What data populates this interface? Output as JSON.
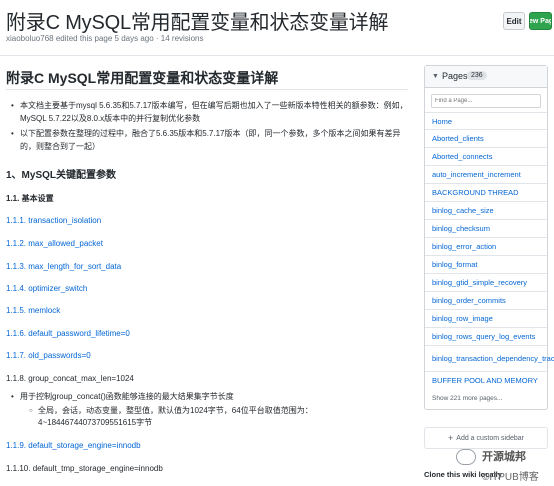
{
  "header": {
    "title": "附录C MySQL常用配置变量和状态变量详解",
    "meta": "xiaoboluo768 edited this page 5 days ago · 14 revisions",
    "edit_label": "Edit",
    "new_page_label": "New Page"
  },
  "content": {
    "h1": "附录C MySQL常用配置变量和状态变量详解",
    "bullets": [
      "本文档主要基于mysql 5.6.35和5.7.17版本编写，但在编写后期也加入了一些新版本特性相关的额参数：例如，MySQL 5.7.22以及8.0.x版本中的并行复制优化参数",
      "以下配置参数在整理的过程中，融合了5.6.35版本和5.7.17版本（即，同一个参数，多个版本之间如果有差异的，则整合到了一起）"
    ],
    "h2": "1、MySQL关键配置参数",
    "h3": "1.1. 基本设置",
    "links": [
      "1.1.1. transaction_isolation",
      "1.1.2. max_allowed_packet",
      "1.1.3. max_length_for_sort_data",
      "1.1.4. optimizer_switch",
      "1.1.5. memlock",
      "1.1.6. default_password_lifetime=0",
      "1.1.7. old_passwords=0"
    ],
    "group_concat_heading": "1.1.8. group_concat_max_len=1024",
    "group_concat_bullet": "用于控制group_concat()函数能够连接的最大结果集字节长度",
    "group_concat_sub": "全局，会话，动态变量，整型值，默认值为1024字节，64位平台取值范围为：4~18446744073709551615字节",
    "link_119": "1.1.9. default_storage_engine=innodb",
    "plain_1110": "1.1.10. default_tmp_storage_engine=innodb"
  },
  "sidebar": {
    "title": "Pages",
    "count": "236",
    "find_placeholder": "Find a Page...",
    "items": [
      "Home",
      "Aborted_clients",
      "Aborted_connects",
      "auto_increment_increment",
      "BACKGROUND THREAD",
      "binlog_cache_size",
      "binlog_checksum",
      "binlog_error_action",
      "binlog_format",
      "binlog_gtid_simple_recovery",
      "binlog_order_commits",
      "binlog_row_image",
      "binlog_rows_query_log_events",
      "binlog_transaction_dependency_tracking",
      "BUFFER POOL AND MEMORY"
    ],
    "show_more": "Show 221 more pages...",
    "add_custom": "Add a custom sidebar",
    "clone_label": "Clone this wiki locally"
  },
  "watermark": {
    "line1": "开源城邦",
    "line2": "©ITPUB博客"
  }
}
